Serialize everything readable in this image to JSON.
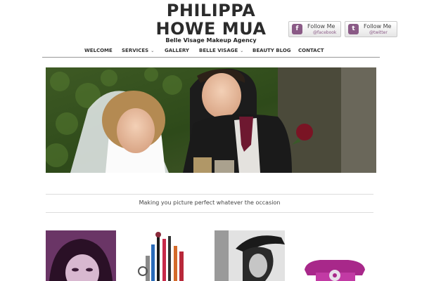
{
  "header": {
    "logo_line1": "PHILIPPA",
    "logo_line2": "HOWE MUA",
    "tagline": "Belle Visage Makeup Agency"
  },
  "social": {
    "facebook": {
      "follow": "Follow Me",
      "handle": "@facebook",
      "icon": "f"
    },
    "twitter": {
      "follow": "Follow Me",
      "handle": "@twitter",
      "icon": "t"
    }
  },
  "nav": {
    "items": [
      {
        "label": "WELCOME"
      },
      {
        "label": "SERVICES",
        "dropdown": true
      },
      {
        "label": "GALLERY"
      },
      {
        "label": "BELLE VISAGE",
        "dropdown": true
      },
      {
        "label": "BEAUTY BLOG"
      },
      {
        "label": "CONTACT"
      }
    ],
    "caret": "⌄"
  },
  "main": {
    "slogan": "Making you picture perfect whatever the occasion",
    "thumbnails": [
      {
        "name": "portrait-purple"
      },
      {
        "name": "makeup-brushes"
      },
      {
        "name": "hat-portrait-bw"
      },
      {
        "name": "pink-telephone"
      }
    ]
  },
  "colors": {
    "accent": "#8a5a86",
    "nav_border": "#999999",
    "text": "#333333"
  }
}
